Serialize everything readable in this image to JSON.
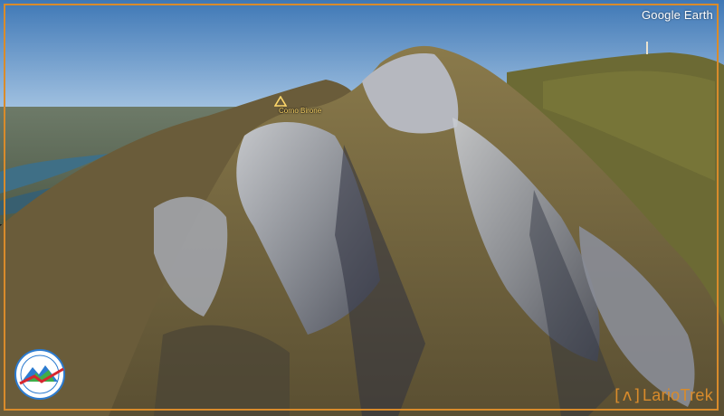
{
  "viewer": {
    "watermark": "Google Earth"
  },
  "placemark": {
    "label": "Corno Birone",
    "icon": "triangle-peak-icon"
  },
  "branding": {
    "mark": "[ʌ]",
    "name": "LarioTrek"
  },
  "badge": {
    "icon": "club-emblem-icon"
  },
  "colors": {
    "frame": "#d98b2b",
    "sky_top": "#3f78b6",
    "sky_bottom": "#a9c7e4",
    "placemark": "#ffd86a"
  }
}
